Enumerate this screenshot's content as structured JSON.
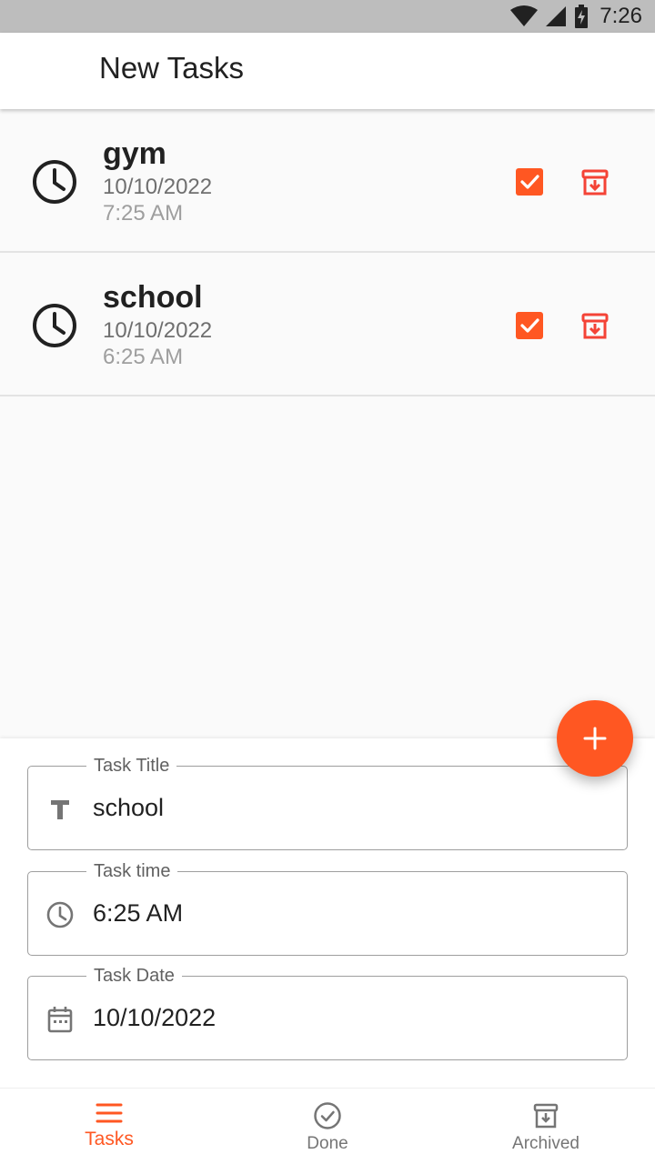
{
  "status_bar": {
    "time": "7:26",
    "icons": [
      "wifi-icon",
      "signal-icon",
      "battery-charging-icon"
    ]
  },
  "app_bar": {
    "title": "New Tasks"
  },
  "tasks": [
    {
      "title": "gym",
      "date": "10/10/2022",
      "time": "7:25 AM"
    },
    {
      "title": "school",
      "date": "10/10/2022",
      "time": "6:25 AM"
    }
  ],
  "form": {
    "title_field": {
      "label": "Task Title",
      "value": "school",
      "icon": "text-fields-icon"
    },
    "time_field": {
      "label": "Task time",
      "value": "6:25 AM",
      "icon": "clock-icon"
    },
    "date_field": {
      "label": "Task Date",
      "value": "10/10/2022",
      "icon": "calendar-icon"
    }
  },
  "fab": {
    "icon": "add-icon"
  },
  "bottom_nav": {
    "items": [
      {
        "label": "Tasks",
        "icon": "menu-icon",
        "active": true
      },
      {
        "label": "Done",
        "icon": "check-circle-icon",
        "active": false
      },
      {
        "label": "Archived",
        "icon": "archive-icon",
        "active": false
      }
    ]
  },
  "colors": {
    "accent": "#ff5722",
    "archive": "#f44336",
    "status_bar": "#bdbdbd",
    "background": "#fafafa"
  }
}
